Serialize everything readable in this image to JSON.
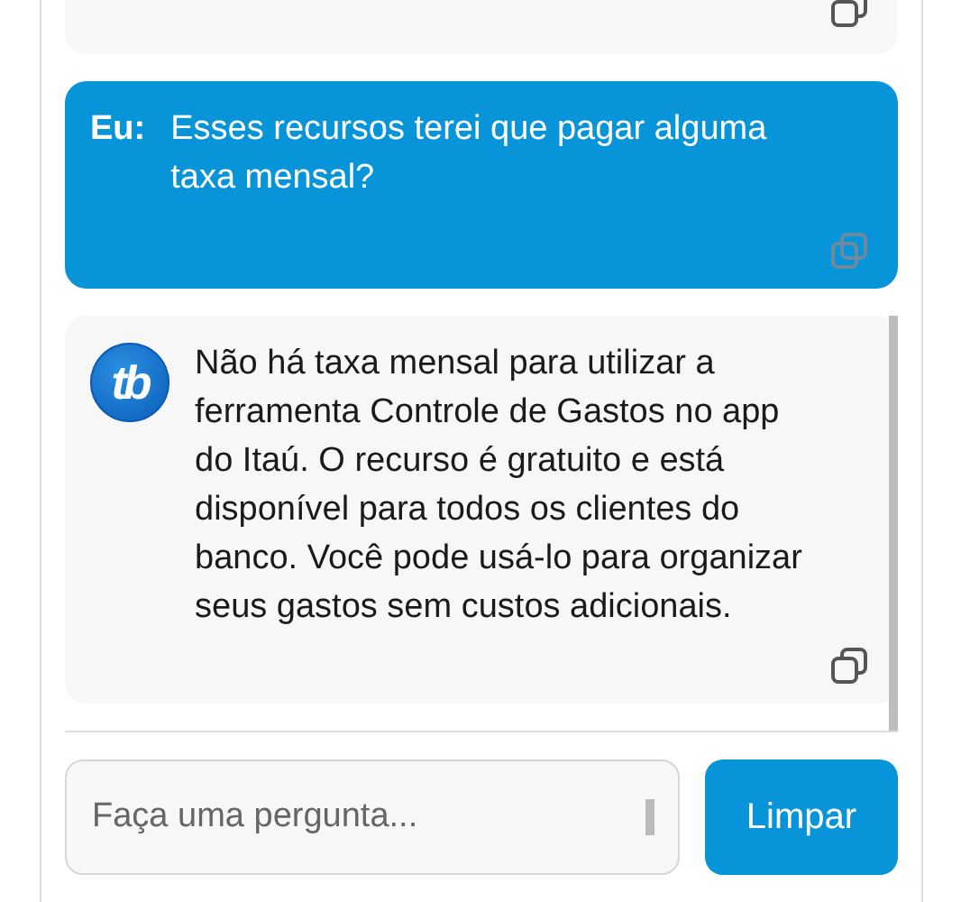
{
  "messages": [
    {
      "kind": "bot",
      "cut_off": true
    },
    {
      "kind": "user",
      "speaker": "Eu:",
      "text": "Esses recursos terei que pagar alguma taxa mensal?"
    },
    {
      "kind": "bot",
      "avatar_text": "tb",
      "text": "Não há taxa mensal para utilizar a ferramenta Controle de Gastos no app do Itaú. O recurso é gratuito e está disponível para todos os clientes do banco. Você pode usá-lo para organizar seus gastos sem custos adicionais."
    }
  ],
  "input": {
    "placeholder": "Faça uma pergunta..."
  },
  "button": "Limpar"
}
